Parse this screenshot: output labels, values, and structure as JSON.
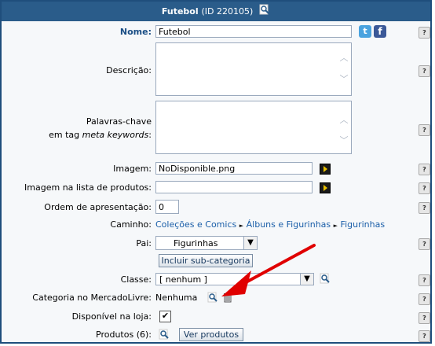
{
  "header": {
    "title": "Futebol",
    "id_text": "(ID 220105)"
  },
  "help_label": "?",
  "fields": {
    "nome_label": "Nome:",
    "nome_value": "Futebol",
    "descricao_label": "Descrição:",
    "palavras_line1": "Palavras-chave",
    "palavras_line2_prefix": "em tag ",
    "palavras_line2_em": "meta keywords",
    "palavras_line2_suffix": ":",
    "imagem_label": "Imagem:",
    "imagem_value": "NoDisponible.png",
    "imagem_lista_label": "Imagem na lista de produtos:",
    "imagem_lista_value": "",
    "ordem_label": "Ordem de apresentação:",
    "ordem_value": "0",
    "caminho_label": "Caminho:",
    "caminho": [
      "Coleções e Comics",
      "Álbuns e Figurinhas",
      "Figurinhas"
    ],
    "pai_label": "Pai:",
    "pai_value": "Figurinhas",
    "incluir_button": "Incluir sub-categoria",
    "classe_label": "Classe:",
    "classe_value": "[ nenhum ]",
    "mercadolivre_label": "Categoria no MercadoLivre:",
    "mercadolivre_value": "Nenhuma",
    "disponivel_label": "Disponível na loja:",
    "disponivel_checked": "✔",
    "produtos_label": "Produtos (6):",
    "ver_produtos_button": "Ver produtos"
  },
  "colors": {
    "header": "#2a5c8a",
    "border": "#1f4e7c",
    "link": "#1a5ea8",
    "arrow": "#e00000"
  }
}
